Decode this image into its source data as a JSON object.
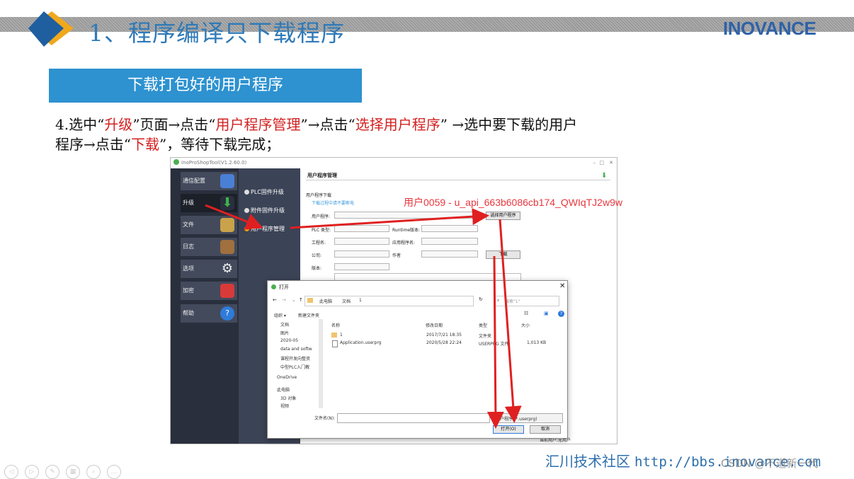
{
  "slide": {
    "title": "1、程序编译只下载程序",
    "brand": "INOVANCE",
    "banner": "下载打包好的用户程序",
    "instruction": {
      "p1": "4.选中“",
      "r1": "升级",
      "p2": "”页面→点击“",
      "r2": "用户程序管理",
      "p3": "”→点击“",
      "r3": "选择用户程序",
      "p4": "” →选中要下载的用户",
      "p5": "程序→点击“",
      "r4": "下载",
      "p6": "”，等待下载完成；"
    },
    "footer_label": "汇川技术社区",
    "footer_url": "http://bbs.inovance.com",
    "watermark": "用户0059 - u_api_663b6086cb174_QWIqTJ2w9w",
    "csdn": "CSDN @不道新一代"
  },
  "app": {
    "title": "InoProShopTool(V1.2.60.0)",
    "win_buttons": [
      "–",
      "□",
      "✕"
    ],
    "sidebar": [
      {
        "label": "通信配置",
        "icon": "network-icon",
        "color": "#4a7fd6"
      },
      {
        "label": "升级",
        "icon": "download-arrow-icon",
        "color": "#3cb44b"
      },
      {
        "label": "文件",
        "icon": "files-icon",
        "color": "#c9a24a"
      },
      {
        "label": "日志",
        "icon": "log-book-icon",
        "color": "#a0703e"
      },
      {
        "label": "选项",
        "icon": "gear-icon",
        "color": "#f0f0f0"
      },
      {
        "label": "加密",
        "icon": "lock-icon",
        "color": "#d83a3a"
      },
      {
        "label": "帮助",
        "icon": "help-icon",
        "color": "#2f7bd9"
      }
    ],
    "menu": [
      "PLC固件升级",
      "附件固件升级",
      "用户程序管理"
    ],
    "panel": {
      "heading": "用户程序管理",
      "section": "用户程序下载",
      "hint": "下载过程中请不要断电",
      "user_program_label": "用户程序:",
      "select_button": "选择用户程序",
      "plc_type_label": "PLC 类型:",
      "runtime_label": "Runtime版本:",
      "project_label": "工程名:",
      "app_label": "应用程序名:",
      "company_label": "公司:",
      "author_label": "作者",
      "download_button": "下载",
      "version_label": "版本:",
      "status": "当前用户:无用户"
    }
  },
  "dialog": {
    "title": "打开",
    "path": [
      "此电脑",
      "文档",
      "1"
    ],
    "search_placeholder": "搜索\"1\"",
    "organize": "组织 ▾",
    "new_folder": "新建文件夹",
    "nav": [
      "文档",
      "图片",
      "2020-05",
      "data and softw",
      "课程开发向整资",
      "中型PLC入门教",
      "OneDrive",
      "此电脑",
      "3D 对象",
      "视频"
    ],
    "columns": [
      "名称",
      "修改日期",
      "类型",
      "大小"
    ],
    "files": [
      {
        "name": "1",
        "date": "2017/7/21 18:35",
        "type": "文件夹",
        "size": ""
      },
      {
        "name": "Application.userprg",
        "date": "2020/5/28 22:24",
        "type": "USERPRG 文件",
        "size": "1,013 KB"
      }
    ],
    "filename_label": "文件名(N):",
    "filter": "用户程序 (*.userprg)",
    "open_button": "打开(O)",
    "cancel_button": "取消"
  },
  "colors": {
    "title_blue": "#2f7ab8",
    "banner_blue": "#2e92d0",
    "arrow_red": "#e02020"
  }
}
